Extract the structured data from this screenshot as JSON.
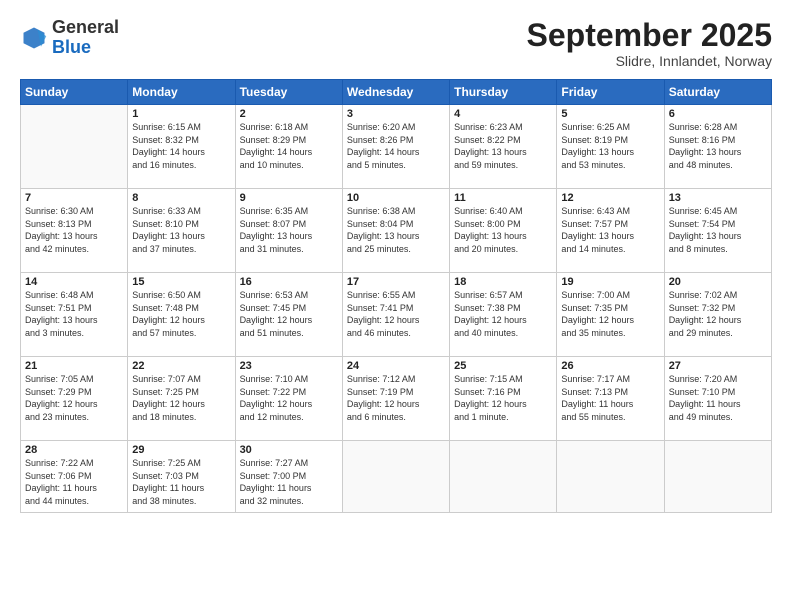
{
  "header": {
    "logo_general": "General",
    "logo_blue": "Blue",
    "month_title": "September 2025",
    "location": "Slidre, Innlandet, Norway"
  },
  "weekdays": [
    "Sunday",
    "Monday",
    "Tuesday",
    "Wednesday",
    "Thursday",
    "Friday",
    "Saturday"
  ],
  "weeks": [
    [
      {
        "day": "",
        "text": ""
      },
      {
        "day": "1",
        "text": "Sunrise: 6:15 AM\nSunset: 8:32 PM\nDaylight: 14 hours\nand 16 minutes."
      },
      {
        "day": "2",
        "text": "Sunrise: 6:18 AM\nSunset: 8:29 PM\nDaylight: 14 hours\nand 10 minutes."
      },
      {
        "day": "3",
        "text": "Sunrise: 6:20 AM\nSunset: 8:26 PM\nDaylight: 14 hours\nand 5 minutes."
      },
      {
        "day": "4",
        "text": "Sunrise: 6:23 AM\nSunset: 8:22 PM\nDaylight: 13 hours\nand 59 minutes."
      },
      {
        "day": "5",
        "text": "Sunrise: 6:25 AM\nSunset: 8:19 PM\nDaylight: 13 hours\nand 53 minutes."
      },
      {
        "day": "6",
        "text": "Sunrise: 6:28 AM\nSunset: 8:16 PM\nDaylight: 13 hours\nand 48 minutes."
      }
    ],
    [
      {
        "day": "7",
        "text": "Sunrise: 6:30 AM\nSunset: 8:13 PM\nDaylight: 13 hours\nand 42 minutes."
      },
      {
        "day": "8",
        "text": "Sunrise: 6:33 AM\nSunset: 8:10 PM\nDaylight: 13 hours\nand 37 minutes."
      },
      {
        "day": "9",
        "text": "Sunrise: 6:35 AM\nSunset: 8:07 PM\nDaylight: 13 hours\nand 31 minutes."
      },
      {
        "day": "10",
        "text": "Sunrise: 6:38 AM\nSunset: 8:04 PM\nDaylight: 13 hours\nand 25 minutes."
      },
      {
        "day": "11",
        "text": "Sunrise: 6:40 AM\nSunset: 8:00 PM\nDaylight: 13 hours\nand 20 minutes."
      },
      {
        "day": "12",
        "text": "Sunrise: 6:43 AM\nSunset: 7:57 PM\nDaylight: 13 hours\nand 14 minutes."
      },
      {
        "day": "13",
        "text": "Sunrise: 6:45 AM\nSunset: 7:54 PM\nDaylight: 13 hours\nand 8 minutes."
      }
    ],
    [
      {
        "day": "14",
        "text": "Sunrise: 6:48 AM\nSunset: 7:51 PM\nDaylight: 13 hours\nand 3 minutes."
      },
      {
        "day": "15",
        "text": "Sunrise: 6:50 AM\nSunset: 7:48 PM\nDaylight: 12 hours\nand 57 minutes."
      },
      {
        "day": "16",
        "text": "Sunrise: 6:53 AM\nSunset: 7:45 PM\nDaylight: 12 hours\nand 51 minutes."
      },
      {
        "day": "17",
        "text": "Sunrise: 6:55 AM\nSunset: 7:41 PM\nDaylight: 12 hours\nand 46 minutes."
      },
      {
        "day": "18",
        "text": "Sunrise: 6:57 AM\nSunset: 7:38 PM\nDaylight: 12 hours\nand 40 minutes."
      },
      {
        "day": "19",
        "text": "Sunrise: 7:00 AM\nSunset: 7:35 PM\nDaylight: 12 hours\nand 35 minutes."
      },
      {
        "day": "20",
        "text": "Sunrise: 7:02 AM\nSunset: 7:32 PM\nDaylight: 12 hours\nand 29 minutes."
      }
    ],
    [
      {
        "day": "21",
        "text": "Sunrise: 7:05 AM\nSunset: 7:29 PM\nDaylight: 12 hours\nand 23 minutes."
      },
      {
        "day": "22",
        "text": "Sunrise: 7:07 AM\nSunset: 7:25 PM\nDaylight: 12 hours\nand 18 minutes."
      },
      {
        "day": "23",
        "text": "Sunrise: 7:10 AM\nSunset: 7:22 PM\nDaylight: 12 hours\nand 12 minutes."
      },
      {
        "day": "24",
        "text": "Sunrise: 7:12 AM\nSunset: 7:19 PM\nDaylight: 12 hours\nand 6 minutes."
      },
      {
        "day": "25",
        "text": "Sunrise: 7:15 AM\nSunset: 7:16 PM\nDaylight: 12 hours\nand 1 minute."
      },
      {
        "day": "26",
        "text": "Sunrise: 7:17 AM\nSunset: 7:13 PM\nDaylight: 11 hours\nand 55 minutes."
      },
      {
        "day": "27",
        "text": "Sunrise: 7:20 AM\nSunset: 7:10 PM\nDaylight: 11 hours\nand 49 minutes."
      }
    ],
    [
      {
        "day": "28",
        "text": "Sunrise: 7:22 AM\nSunset: 7:06 PM\nDaylight: 11 hours\nand 44 minutes."
      },
      {
        "day": "29",
        "text": "Sunrise: 7:25 AM\nSunset: 7:03 PM\nDaylight: 11 hours\nand 38 minutes."
      },
      {
        "day": "30",
        "text": "Sunrise: 7:27 AM\nSunset: 7:00 PM\nDaylight: 11 hours\nand 32 minutes."
      },
      {
        "day": "",
        "text": ""
      },
      {
        "day": "",
        "text": ""
      },
      {
        "day": "",
        "text": ""
      },
      {
        "day": "",
        "text": ""
      }
    ]
  ]
}
